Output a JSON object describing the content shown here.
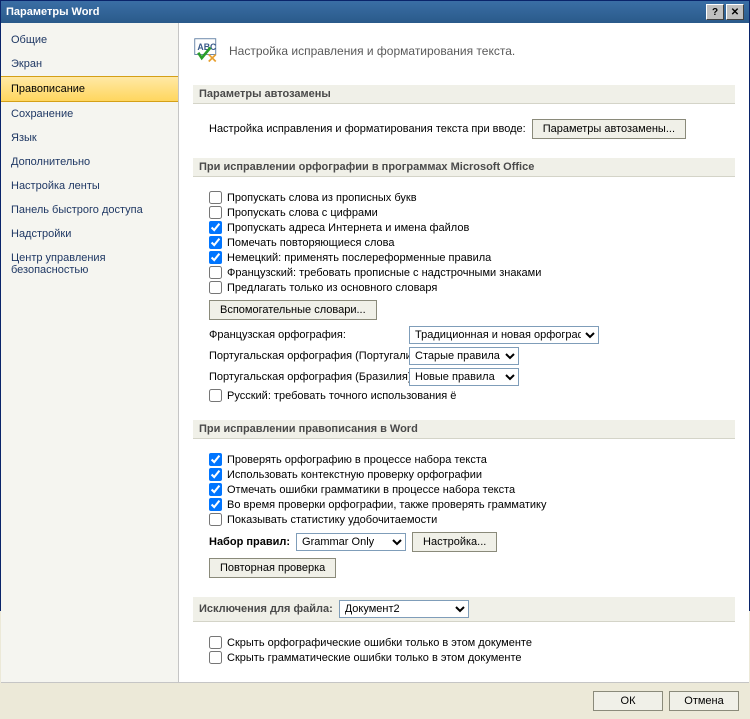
{
  "window": {
    "title": "Параметры Word"
  },
  "sidebar": {
    "items": [
      {
        "label": "Общие"
      },
      {
        "label": "Экран"
      },
      {
        "label": "Правописание"
      },
      {
        "label": "Сохранение"
      },
      {
        "label": "Язык"
      },
      {
        "label": "Дополнительно"
      },
      {
        "label": "Настройка ленты"
      },
      {
        "label": "Панель быстрого доступа"
      },
      {
        "label": "Надстройки"
      },
      {
        "label": "Центр управления безопасностью"
      }
    ]
  },
  "header": {
    "text": "Настройка исправления и форматирования текста."
  },
  "sections": {
    "autocorrect": {
      "title": "Параметры автозамены",
      "desc": "Настройка исправления и форматирования текста при вводе:",
      "button": "Параметры автозамены..."
    },
    "office": {
      "title": "При исправлении орфографии в программах Microsoft Office",
      "c1": "Пропускать слова из прописных букв",
      "c2": "Пропускать слова с цифрами",
      "c3": "Пропускать адреса Интернета и имена файлов",
      "c4": "Помечать повторяющиеся слова",
      "c5": "Немецкий: применять послереформенные правила",
      "c6": "Французский: требовать прописные с надстрочными знаками",
      "c7": "Предлагать только из основного словаря",
      "custom_dict_btn": "Вспомогательные словари...",
      "french_label": "Французская орфография:",
      "french_value": "Традиционная и новая орфография",
      "pt_pt_label": "Португальская орфография (Португалия):",
      "pt_pt_value": "Старые правила",
      "pt_br_label": "Португальская орфография (Бразилия):",
      "pt_br_value": "Новые правила",
      "russian": "Русский: требовать точного использования ё"
    },
    "word": {
      "title": "При исправлении правописания в Word",
      "c1": "Проверять орфографию в процессе набора текста",
      "c2": "Использовать контекстную проверку орфографии",
      "c3": "Отмечать ошибки грамматики в процессе набора текста",
      "c4": "Во время проверки орфографии, также проверять грамматику",
      "c5": "Показывать статистику удобочитаемости",
      "rules_label": "Набор правил:",
      "rules_value": "Grammar Only",
      "settings_btn": "Настройка...",
      "recheck_btn": "Повторная проверка"
    },
    "exceptions": {
      "title": "Исключения для файла:",
      "file_value": "Документ2",
      "c1": "Скрыть орфографические ошибки только в этом документе",
      "c2": "Скрыть грамматические ошибки только в этом документе"
    }
  },
  "footer": {
    "ok": "ОК",
    "cancel": "Отмена"
  }
}
